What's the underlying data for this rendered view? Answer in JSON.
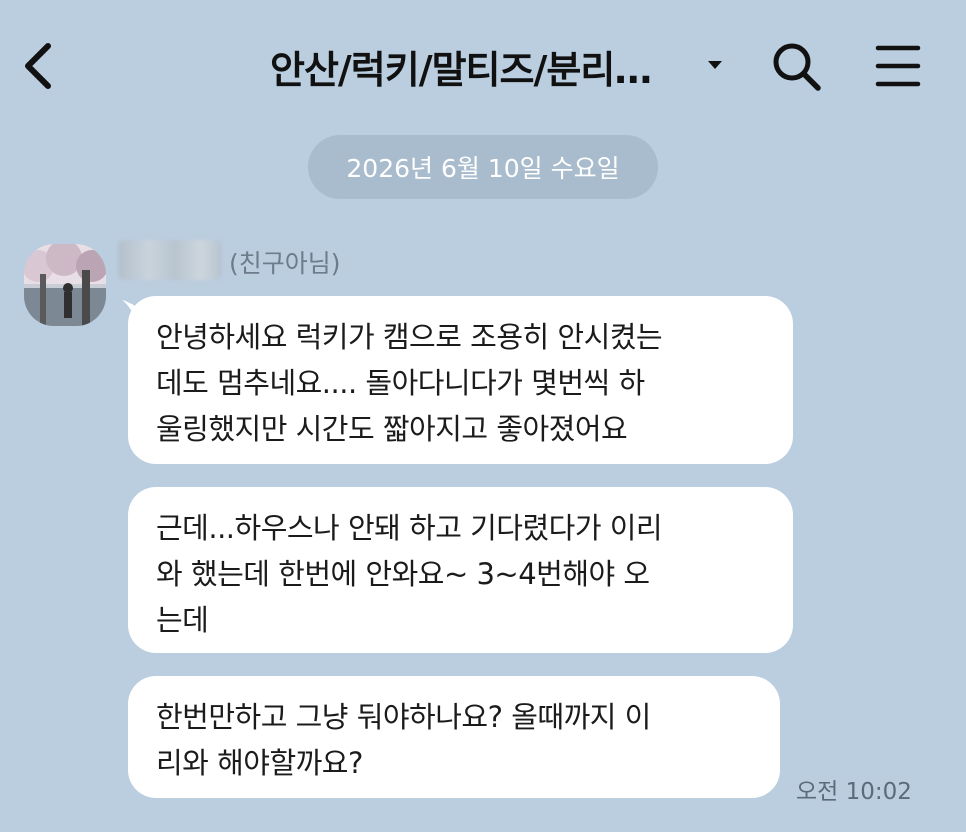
{
  "header": {
    "title": "안산/럭키/말티즈/분리…",
    "icons": {
      "back": "chevron-left-icon",
      "dropdown": "caret-down-icon",
      "search": "search-icon",
      "menu": "hamburger-menu-icon"
    }
  },
  "date_divider": "2026년 6월 10일 수요일",
  "sender": {
    "name": "",
    "tag": "(친구아님)"
  },
  "messages": [
    {
      "lines": [
        "안녕하세요 럭키가 캠으로 조용히 안시켰는",
        "데도 멈추네요.... 돌아다니다가 몇번씩 하",
        "울링했지만 시간도 짧아지고 좋아졌어요"
      ]
    },
    {
      "lines": [
        "근데...하우스나 안돼 하고 기다렸다가 이리",
        "와 했는데 한번에 안와요~ 3~4번해야 오",
        "는데"
      ]
    },
    {
      "lines": [
        "한번만하고 그냥 둬야하나요? 올때까지 이",
        "리와 해야할까요?"
      ],
      "time": "오전 10:02"
    }
  ],
  "colors": {
    "background": "#bacee0",
    "date_pill": "#a9bccd",
    "bubble": "#ffffff",
    "meta_text": "#6d7c8b"
  }
}
